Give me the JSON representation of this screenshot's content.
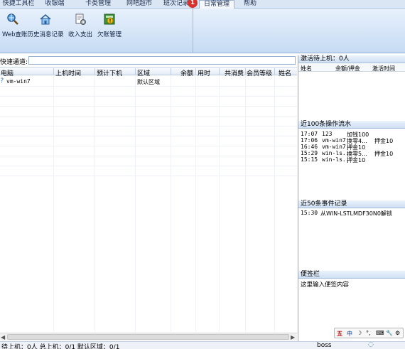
{
  "menu": {
    "tabs": [
      "快捷工具栏",
      "收银端",
      "卡类管理",
      "网吧超市",
      "班次记录",
      "日常管理",
      "帮助"
    ],
    "badge": "1"
  },
  "ribbon": {
    "buttons": [
      {
        "label": "Web查账",
        "icon": "magnifier-globe-icon"
      },
      {
        "label": "历史消息记录",
        "icon": "house-icon"
      },
      {
        "label": "收入支出",
        "icon": "gear-document-icon"
      },
      {
        "label": "欠账管理",
        "icon": "warning-ledger-icon"
      }
    ]
  },
  "quick": {
    "label": "快速通道:"
  },
  "table": {
    "columns": [
      "电脑",
      "上机时间",
      "预计下机",
      "区域",
      "余额",
      "用时",
      "共消费",
      "会员等级",
      "姓名"
    ],
    "rows": [
      {
        "pc": "vm-win7",
        "zone": "默认区域"
      }
    ]
  },
  "right": {
    "active_title": "激活待上机：0人",
    "active_cols": [
      "姓名",
      "余额/押金",
      "激活时间"
    ],
    "ops_title": "近100条操作流水",
    "ops": [
      {
        "time": "17:07",
        "user": "123",
        "action": "加钱100"
      },
      {
        "time": "17:06",
        "user": "vm-win7",
        "action": "换零4...",
        "extra": "押金10"
      },
      {
        "time": "16:46",
        "user": "vm-win7",
        "action": "押金10"
      },
      {
        "time": "15:29",
        "user": "win-ls..",
        "action": "换零5...",
        "extra": "押金10"
      },
      {
        "time": "15:15",
        "user": "win-ls..",
        "action": "押金10"
      }
    ],
    "events_title": "近50条事件记录",
    "events": [
      {
        "time": "15:30",
        "text": "从WIN-LSTLMDF30N0解锁"
      }
    ],
    "memo_title": "便签栏",
    "memo_text": "这里输入便签内容"
  },
  "ime": {
    "items": [
      "五",
      "中",
      "☽",
      "°,",
      "⌨",
      "🔧",
      "⚙"
    ]
  },
  "status": {
    "text": "待上机：0人 总上机：0/1 默认区域：0/1",
    "user": "boss"
  }
}
